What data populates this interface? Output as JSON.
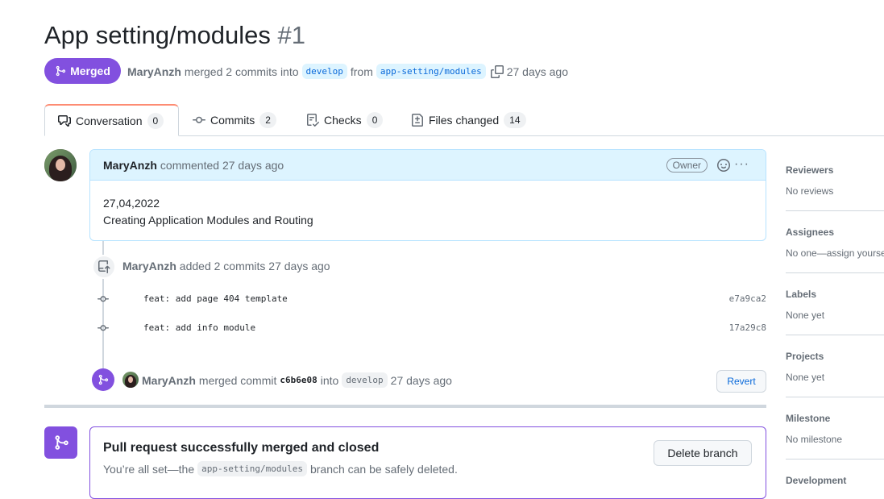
{
  "header": {
    "title": "App setting/modules",
    "number": "#1",
    "state": "Merged",
    "author": "MaryAnzh",
    "merged_text": "merged 2 commits into",
    "base_branch": "develop",
    "from_text": "from",
    "head_branch": "app-setting/modules",
    "time": "27 days ago"
  },
  "tabs": [
    {
      "label": "Conversation",
      "count": "0",
      "icon": "comment-discussion-icon"
    },
    {
      "label": "Commits",
      "count": "2",
      "icon": "git-commit-icon"
    },
    {
      "label": "Checks",
      "count": "0",
      "icon": "checklist-icon"
    },
    {
      "label": "Files changed",
      "count": "14",
      "icon": "file-diff-icon"
    }
  ],
  "comment": {
    "author": "MaryAnzh",
    "action": "commented 27 days ago",
    "role_label": "Owner",
    "body_line1": "27,04,2022",
    "body_line2": "Creating Application Modules and Routing"
  },
  "timeline": {
    "commits_event": {
      "author": "MaryAnzh",
      "text": "added 2 commits 27 days ago"
    },
    "commits": [
      {
        "message": "feat: add page 404 template",
        "sha": "e7a9ca2"
      },
      {
        "message": "feat: add info module",
        "sha": "17a29c8"
      }
    ],
    "merge_event": {
      "author": "MaryAnzh",
      "text_before": "merged commit",
      "sha": "c6b6e08",
      "text_into": "into",
      "branch": "develop",
      "time": "27 days ago",
      "revert_label": "Revert"
    }
  },
  "merge_box": {
    "title": "Pull request successfully merged and closed",
    "desc_before": "You’re all set—the",
    "branch": "app-setting/modules",
    "desc_after": "branch can be safely deleted.",
    "delete_label": "Delete branch"
  },
  "sidebar": [
    {
      "heading": "Reviewers",
      "value": "No reviews"
    },
    {
      "heading": "Assignees",
      "value": "No one—assign yourself"
    },
    {
      "heading": "Labels",
      "value": "None yet"
    },
    {
      "heading": "Projects",
      "value": "None yet"
    },
    {
      "heading": "Milestone",
      "value": "No milestone"
    },
    {
      "heading": "Development",
      "value": ""
    }
  ],
  "colors": {
    "merged_purple": "#8250df",
    "link_blue": "#0969da",
    "tab_accent": "#fd8c73"
  }
}
